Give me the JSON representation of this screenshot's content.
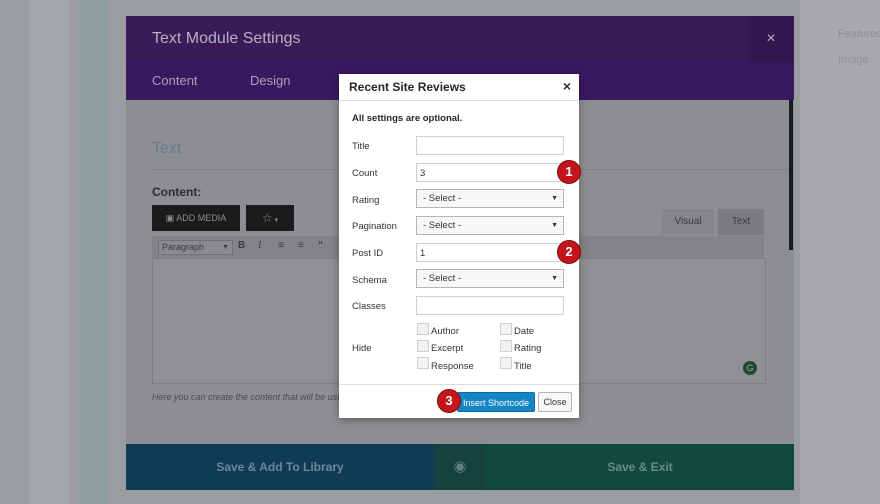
{
  "background": {
    "right_panel_lines": [
      "Featured",
      "Image"
    ]
  },
  "modal": {
    "title": "Text Module Settings",
    "close_glyph": "×",
    "tabs": [
      "Content",
      "Design"
    ],
    "section_title": "Text",
    "content_label": "Content:",
    "add_media_label": "ADD MEDIA",
    "editor_tabs": {
      "visual": "Visual",
      "text": "Text"
    },
    "format_select": "Paragraph",
    "help_text": "Here you can create the content that will be used",
    "footer": {
      "save_library": "Save & Add To Library",
      "save_exit": "Save & Exit"
    }
  },
  "dialog": {
    "title": "Recent Site Reviews",
    "close_glyph": "×",
    "note": "All settings are optional.",
    "fields": {
      "title": {
        "label": "Title",
        "value": ""
      },
      "count": {
        "label": "Count",
        "value": "3"
      },
      "rating": {
        "label": "Rating",
        "value": "- Select -"
      },
      "pagination": {
        "label": "Pagination",
        "value": "- Select -"
      },
      "post_id": {
        "label": "Post ID",
        "value": "1"
      },
      "schema": {
        "label": "Schema",
        "value": "- Select -"
      },
      "classes": {
        "label": "Classes",
        "value": ""
      }
    },
    "hide": {
      "label": "Hide",
      "options": [
        "Author",
        "Date",
        "Excerpt",
        "Rating",
        "Response",
        "Title"
      ]
    },
    "insert_label": "Insert Shortcode",
    "close_label": "Close"
  },
  "markers": [
    "1",
    "2",
    "3"
  ],
  "colors": {
    "header": "#3b1a58",
    "primary_button": "#1685c4",
    "marker": "#c4151c"
  }
}
